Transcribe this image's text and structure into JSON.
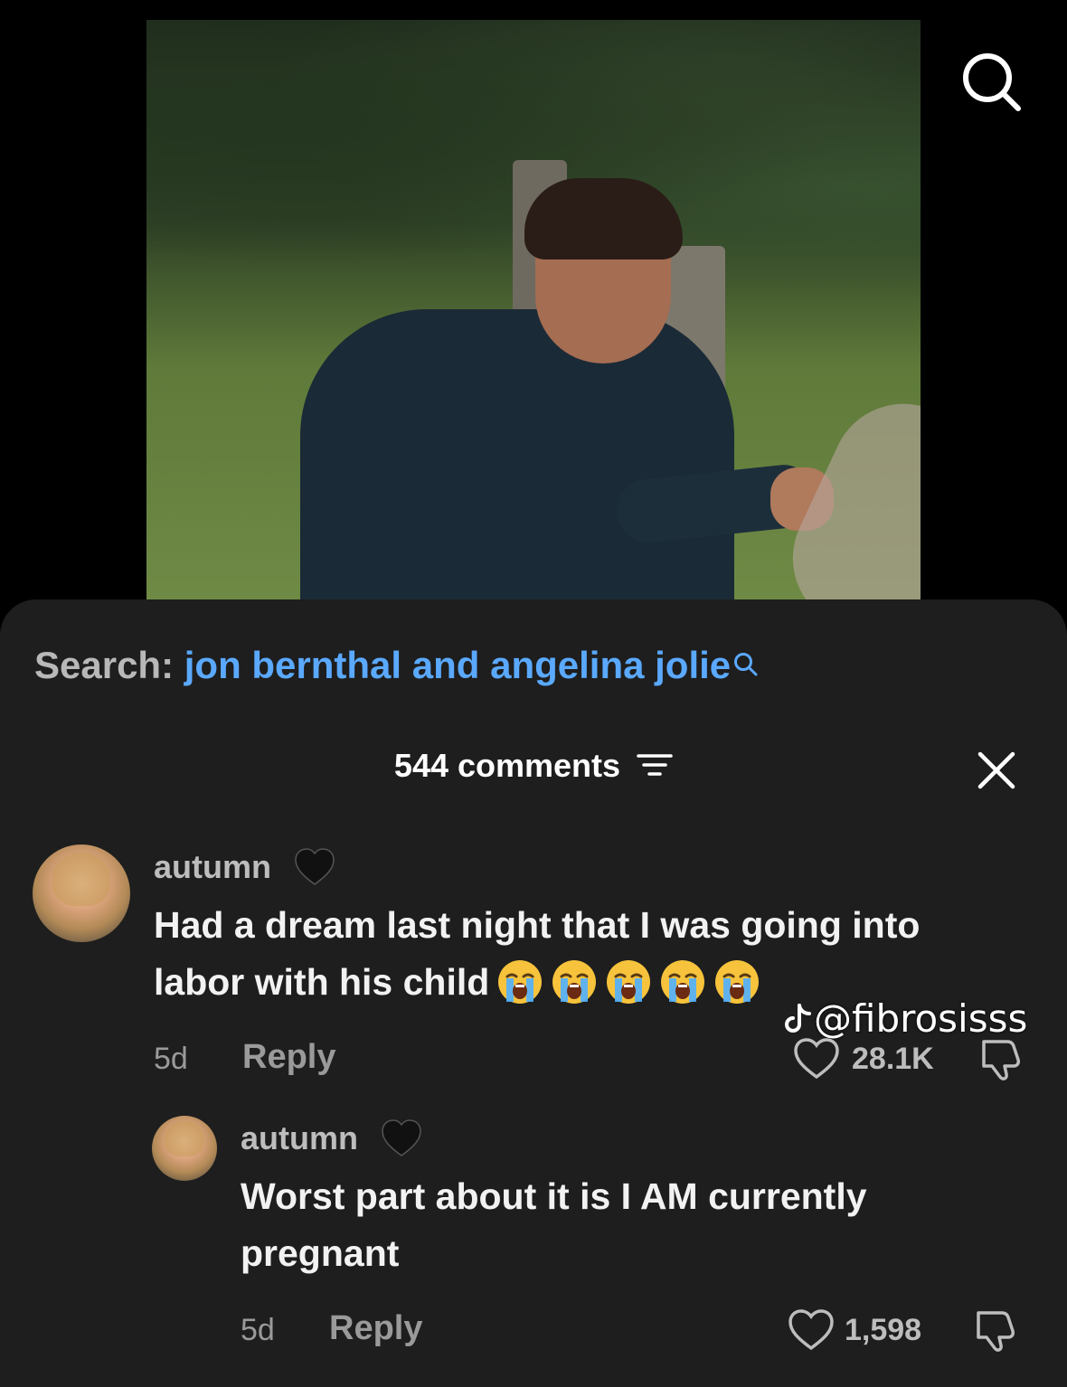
{
  "search": {
    "label": "Search:",
    "query": "jon bernthal and angelina jolie"
  },
  "comments": {
    "count_label": "544 comments"
  },
  "watermark": "@fibrosisss",
  "comment1": {
    "username": "autumn",
    "line1": "Had a dream last night that I was going into",
    "line2": "labor with his child",
    "emoji_name": "loudly-crying-face",
    "age": "5d",
    "reply_label": "Reply",
    "likes": "28.1K"
  },
  "comment2": {
    "username": "autumn",
    "line1": "Worst part about it is I AM currently",
    "line2": "pregnant",
    "age": "5d",
    "reply_label": "Reply",
    "likes": "1,598"
  },
  "colors": {
    "accent_blue": "#5aa9ff",
    "sheet_bg": "#1e1e1e"
  }
}
